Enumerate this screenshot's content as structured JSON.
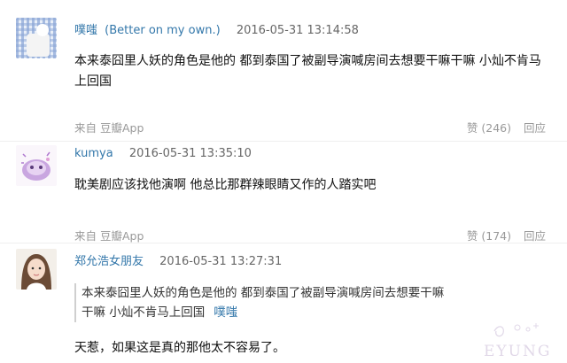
{
  "comments": [
    {
      "user": "噗嗤",
      "user_note": "(Better on my own.)",
      "time": "2016-05-31 13:14:58",
      "text": "本来泰囧里人妖的角色是他的 都到泰国了被副导演喊房间去想要干嘛干嘛 小灿不肯马上回国",
      "source": "来自 豆瓣App",
      "likes": "赞 (246)",
      "reply": "回应"
    },
    {
      "user": "kumya",
      "time": "2016-05-31 13:35:10",
      "text": "耽美剧应该找他演啊 他总比那群辣眼睛又作的人踏实吧",
      "source": "来自 豆瓣App",
      "likes": "赞 (174)",
      "reply": "回应"
    },
    {
      "user": "郑允浩女朋友",
      "time": "2016-05-31 13:27:31",
      "quote": {
        "text": "本来泰囧里人妖的角色是他的 都到泰国了被副导演喊房间去想要干嘛干嘛 小灿不肯马上回国",
        "author": "噗嗤"
      },
      "text": "天惹，如果这是真的那他太不容易了。"
    }
  ],
  "watermark_text": "EYUNG"
}
